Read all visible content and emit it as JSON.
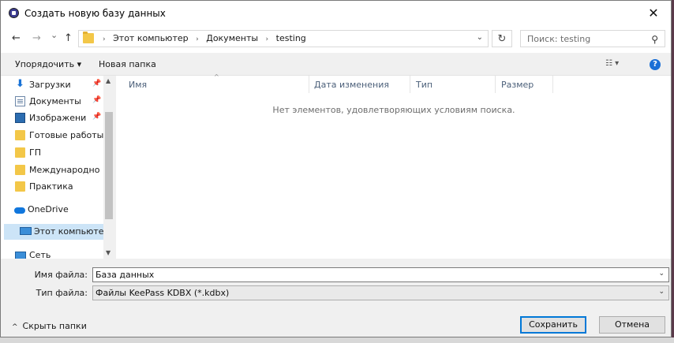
{
  "window": {
    "title": "Создать новую базу данных",
    "close_glyph": "✕"
  },
  "nav": {
    "back_glyph": "←",
    "forward_glyph": "→",
    "recent_glyph": "⌄",
    "up_glyph": "↑",
    "breadcrumbs": [
      "Этот компьютер",
      "Документы",
      "testing"
    ],
    "refresh_glyph": "↻",
    "search_placeholder": "Поиск: testing"
  },
  "toolbar": {
    "organize_label": "Упорядочить ▾",
    "new_folder_label": "Новая папка",
    "help_label": "?"
  },
  "sidebar": {
    "items": [
      {
        "label": "Загрузки",
        "icon": "download-icon",
        "pinned": true
      },
      {
        "label": "Документы",
        "icon": "documents-icon",
        "pinned": true
      },
      {
        "label": "Изображени",
        "icon": "pictures-icon",
        "pinned": true
      },
      {
        "label": "Готовые работы",
        "icon": "folder-icon",
        "pinned": false
      },
      {
        "label": "ГП",
        "icon": "folder-icon",
        "pinned": false
      },
      {
        "label": "Международно",
        "icon": "folder-icon",
        "pinned": false
      },
      {
        "label": "Практика",
        "icon": "folder-icon",
        "pinned": false
      },
      {
        "label": "OneDrive",
        "icon": "onedrive-icon",
        "pinned": false
      },
      {
        "label": "Этот компьютер",
        "icon": "computer-icon",
        "pinned": false,
        "selected": true
      },
      {
        "label": "Сеть",
        "icon": "network-icon",
        "pinned": false
      }
    ]
  },
  "file_list": {
    "columns": [
      "Имя",
      "Дата изменения",
      "Тип",
      "Размер"
    ],
    "empty_message": "Нет элементов, удовлетворяющих условиям поиска."
  },
  "form": {
    "filename_label": "Имя файла:",
    "filename_value": "База данных",
    "filetype_label": "Тип файла:",
    "filetype_value": "Файлы KeePass KDBX (*.kdbx)"
  },
  "footer": {
    "hide_folders_label": "Скрыть папки",
    "save_label": "Сохранить",
    "cancel_label": "Отмена"
  },
  "colors": {
    "accent": "#0078d7",
    "selection": "#cce4f7",
    "folder": "#f3c748"
  }
}
